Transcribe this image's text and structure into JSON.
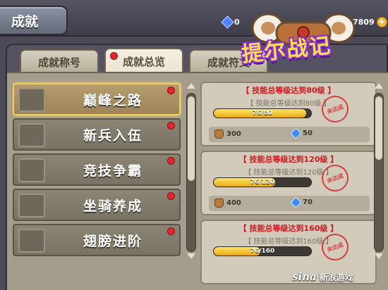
{
  "window": {
    "title": "成就"
  },
  "currency": [
    {
      "icon": "gem-icon",
      "value": "0"
    },
    {
      "icon": "gem-icon",
      "value": "7809"
    }
  ],
  "logo": {
    "text": "提尔战记"
  },
  "tabs": [
    {
      "label": "成就称号",
      "active": false,
      "dot": false
    },
    {
      "label": "成就总览",
      "active": true,
      "dot": true
    },
    {
      "label": "成就符文",
      "active": false,
      "dot": false
    }
  ],
  "list": [
    {
      "label": "巅峰之路",
      "selected": true
    },
    {
      "label": "新兵入伍",
      "selected": false
    },
    {
      "label": "竞技争霸",
      "selected": false
    },
    {
      "label": "坐骑养成",
      "selected": false
    },
    {
      "label": "翅膀进阶",
      "selected": false
    }
  ],
  "cards": [
    {
      "title": "【 技能总等级达到80级 】",
      "subtitle": "【 技能总等级达到80级 】",
      "progress_text": "76/80",
      "progress": 0.95,
      "stamp": "未达成",
      "reward_bag": "300",
      "reward_gem": "50"
    },
    {
      "title": "【 技能总等级达到120级 】",
      "subtitle": "【 技能总等级达到120级 】",
      "progress_text": "76/120",
      "progress": 0.633,
      "stamp": "未达成",
      "reward_bag": "400",
      "reward_gem": "70"
    },
    {
      "title": "【 技能总等级达到160级 】",
      "subtitle": "【 技能总等级达到160级 】",
      "progress_text": "76/160",
      "progress": 0.475,
      "stamp": "未达成",
      "reward_bag": "",
      "reward_gem": ""
    }
  ],
  "watermark": {
    "logo": "sina",
    "text": "新浪游戏"
  }
}
